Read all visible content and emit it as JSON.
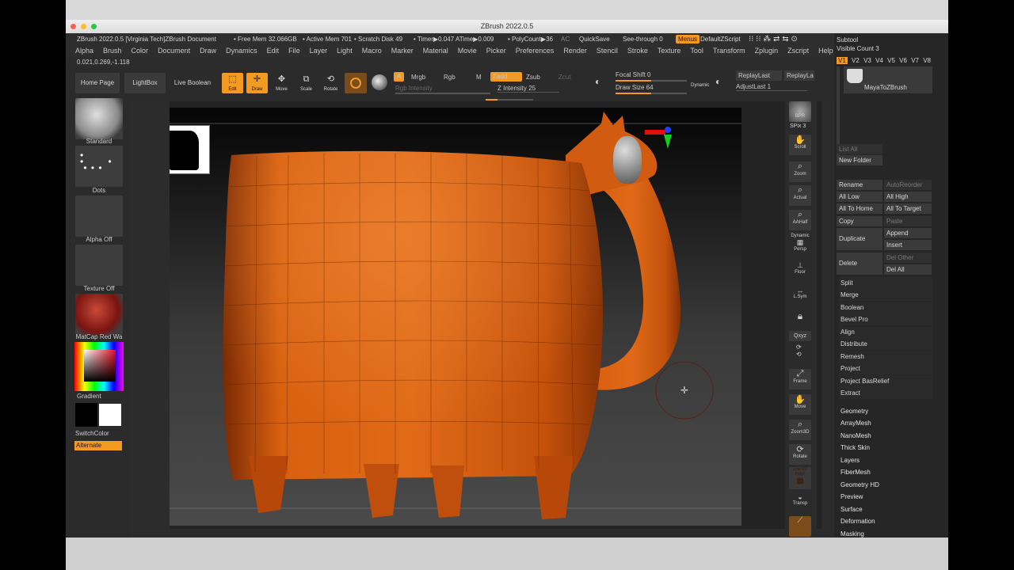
{
  "window": {
    "title": "ZBrush 2022.0.5"
  },
  "infobar": {
    "doc": "ZBrush 2022.0.5 [Virginia Tech]ZBrush Document",
    "free_mem": "• Free Mem 32.066GB",
    "active_mem": "• Active Mem 701",
    "scratch": "• Scratch Disk 49",
    "timer": "• Timer▶0.047 ATime▶0.009",
    "polycount": "• PolyCount▶36",
    "ac": "AC",
    "quicksave": "QuickSave",
    "see_through": "See-through  0",
    "menus": "Menus",
    "default_zscript": "DefaultZScript"
  },
  "menubar": [
    "Alpha",
    "Brush",
    "Color",
    "Document",
    "Draw",
    "Dynamics",
    "Edit",
    "File",
    "Layer",
    "Light",
    "Macro",
    "Marker",
    "Material",
    "Movie",
    "Picker",
    "Preferences",
    "Render",
    "Stencil",
    "Stroke",
    "Texture",
    "Tool",
    "Transform",
    "Zplugin",
    "Zscript",
    "Help"
  ],
  "coords": "0.021,0.269,-1.118",
  "toolbar": {
    "home_page": "Home Page",
    "lightbox": "LightBox",
    "live_boolean": "Live Boolean",
    "edit": "Edit",
    "draw": "Draw",
    "move": "Move",
    "scale": "Scale",
    "rotate": "Rotate",
    "a": "A",
    "mrgb": "Mrgb",
    "rgb": "Rgb",
    "m": "M",
    "zadd": "Zadd",
    "zsub": "Zsub",
    "zcut": "Zcut",
    "rgb_intensity": "Rgb Intensity",
    "z_intensity": "Z Intensity 25",
    "z_intensity_level": 0.25,
    "focal_shift": "Focal Shift 0",
    "draw_size": "Draw Size 64",
    "draw_size_level": 0.5,
    "dynamic": "Dynamic",
    "replay_last": "ReplayLast",
    "replay_last_rel": "ReplayLa",
    "adjust_last": "AdjustLast 1"
  },
  "leftshelf": {
    "brush": "Standard",
    "stroke": "Dots",
    "alpha": "Alpha Off",
    "texture": "Texture Off",
    "material": "MatCap Red Wa",
    "gradient": "Gradient",
    "switch_color": "SwitchColor",
    "alternate": "Alternate"
  },
  "rightshelf": [
    "BPR",
    "SPix 3",
    "Scroll",
    "Zoom",
    "Actual",
    "AAHalf",
    "Dynamic",
    "Persp",
    "Floor",
    "L.Sym",
    "",
    "Qxyz",
    "",
    "Frame",
    "Move",
    "Zoom3D",
    "Rotate",
    "Line Fill PolyF",
    "Transp",
    ""
  ],
  "tray": {
    "subtool": "Subtool",
    "visible_count": "Visible Count 3",
    "versions": [
      "V1",
      "V2",
      "V3",
      "V4",
      "V5",
      "V6",
      "V7",
      "V8"
    ],
    "subtool_name": "MayaToZBrush",
    "list_all": "List All",
    "new_folder": "New Folder",
    "rename": "Rename",
    "auto_reorder": "AutoReorder",
    "all_low": "All Low",
    "all_high": "All High",
    "all_to_home": "All To Home",
    "all_to_target": "All To Target",
    "copy": "Copy",
    "paste": "Paste",
    "duplicate": "Duplicate",
    "append": "Append",
    "insert": "Insert",
    "delete": "Delete",
    "del_other": "Del Other",
    "del_all": "Del All",
    "palettes": [
      "Split",
      "Merge",
      "Boolean",
      "Bevel Pro",
      "Align",
      "Distribute",
      "Remesh",
      "Project",
      "Project BasRelief",
      "Extract"
    ],
    "sections": [
      "Geometry",
      "ArrayMesh",
      "NanoMesh",
      "Thick Skin",
      "Layers",
      "FiberMesh",
      "Geometry HD",
      "Preview",
      "Surface",
      "Deformation",
      "Masking"
    ]
  },
  "colors": {
    "accent": "#f29a22",
    "mesh": "#d85a14",
    "panel": "#2c2c2c"
  }
}
